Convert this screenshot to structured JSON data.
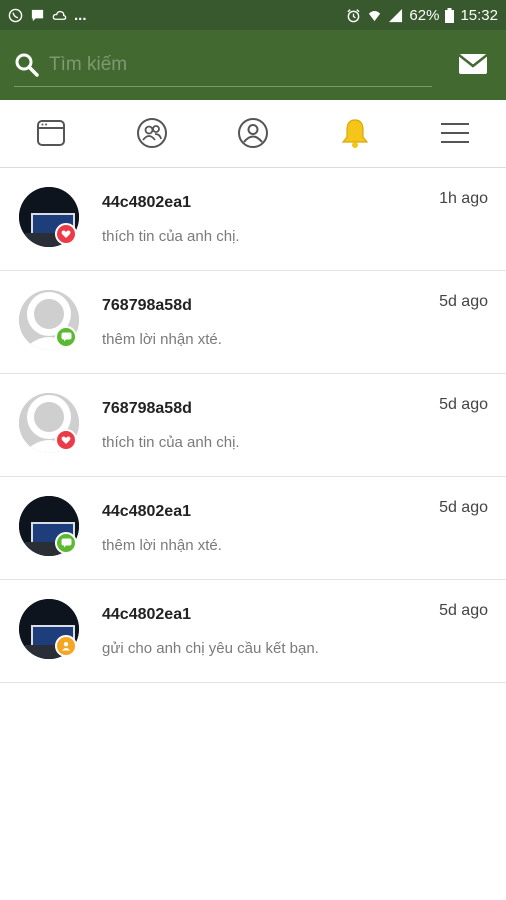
{
  "statusbar": {
    "battery": "62%",
    "time": "15:32",
    "dots": "..."
  },
  "search": {
    "placeholder": "Tìm kiếm"
  },
  "colors": {
    "header": "#42692f",
    "statusbar": "#38582d",
    "bell_active": "#f5c518",
    "heart_badge": "#ec3b47",
    "comment_badge": "#5cb932",
    "friend_badge": "#f5a623"
  },
  "tabs": [
    {
      "icon": "feed-icon"
    },
    {
      "icon": "friends-icon"
    },
    {
      "icon": "profile-icon"
    },
    {
      "icon": "bell-icon",
      "active": true
    },
    {
      "icon": "menu-icon"
    }
  ],
  "notifications": [
    {
      "name": "44c4802ea1",
      "time": "1h ago",
      "message": "thích tin của anh chị.",
      "avatar": "photo",
      "badge": "heart-badge-icon"
    },
    {
      "name": "768798a58d",
      "time": "5d ago",
      "message": "thêm lời nhận xté.",
      "avatar": "default",
      "badge": "comment-badge-icon"
    },
    {
      "name": "768798a58d",
      "time": "5d ago",
      "message": "thích tin của anh chị.",
      "avatar": "default",
      "badge": "heart-badge-icon"
    },
    {
      "name": "44c4802ea1",
      "time": "5d ago",
      "message": "thêm lời nhận xté.",
      "avatar": "photo",
      "badge": "comment-badge-icon"
    },
    {
      "name": "44c4802ea1",
      "time": "5d ago",
      "message": "gửi cho anh chị yêu cầu kết bạn.",
      "avatar": "photo",
      "badge": "friend-badge-icon"
    }
  ]
}
